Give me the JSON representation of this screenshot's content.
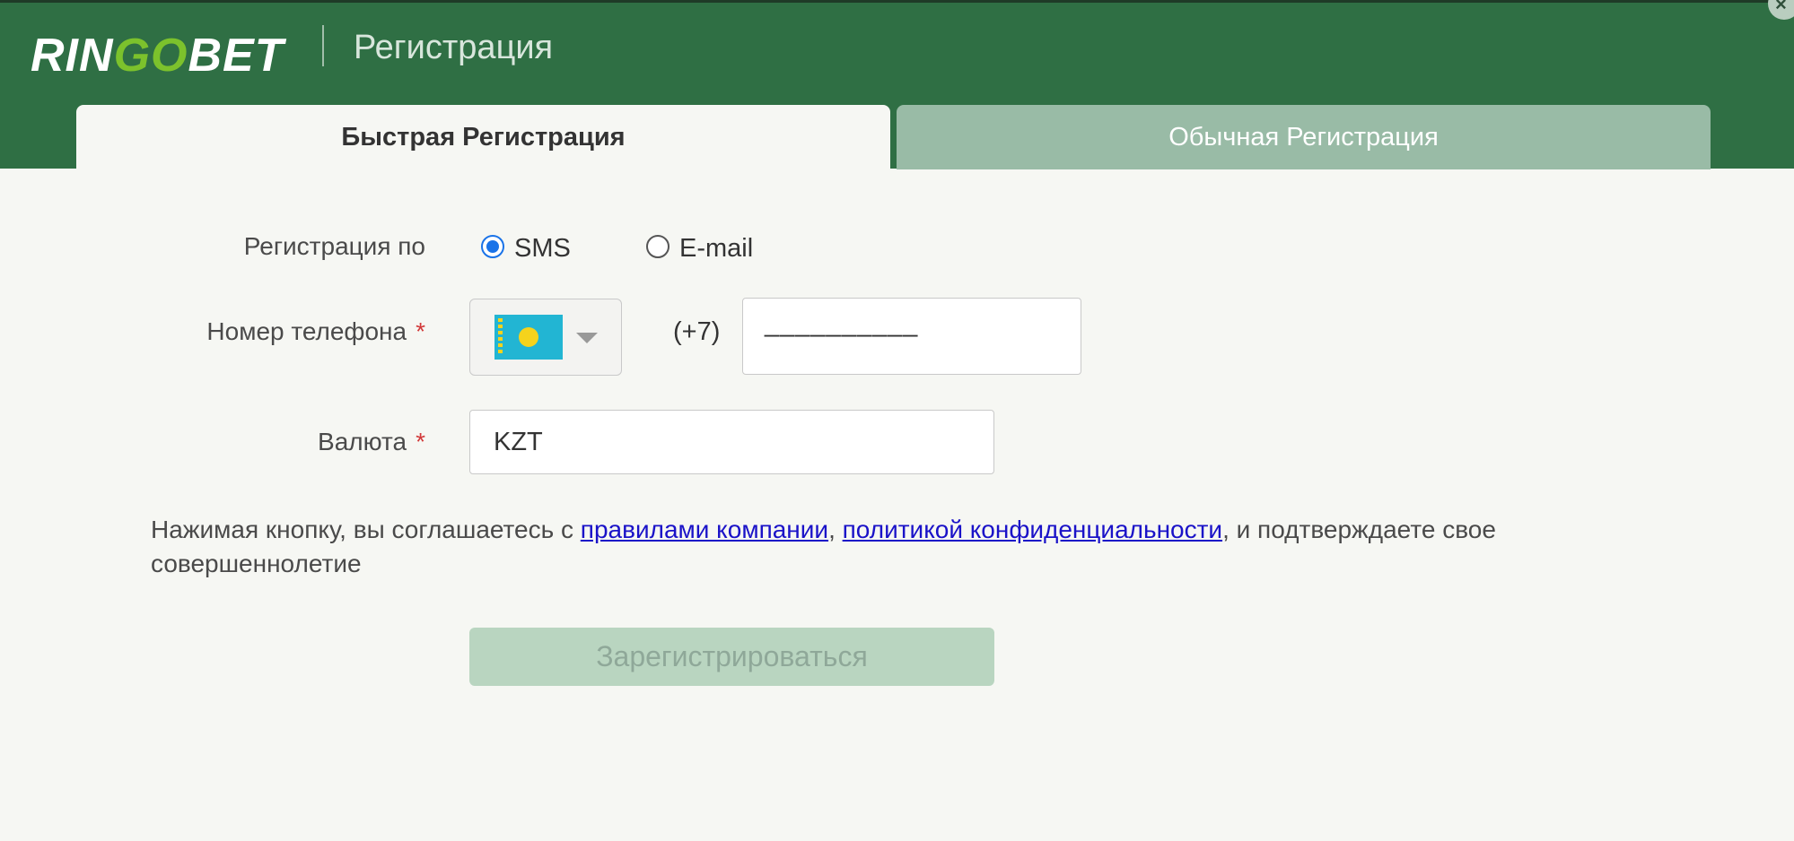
{
  "header": {
    "logo_ring": "RIN",
    "logo_go": "GO",
    "logo_bet": "BET",
    "title": "Регистрация",
    "close_label": "×"
  },
  "tabs": [
    {
      "label": "Быстрая Регистрация",
      "active": true
    },
    {
      "label": "Обычная Регистрация",
      "active": false
    }
  ],
  "form": {
    "registration_by_label": "Регистрация по",
    "options": [
      {
        "label": "SMS",
        "selected": true
      },
      {
        "label": "E-mail",
        "selected": false
      }
    ],
    "phone": {
      "label": "Номер телефона",
      "required_mark": "*",
      "country_flag": "kazakhstan-flag-icon",
      "prefix": "(+7)",
      "value": "__________"
    },
    "currency": {
      "label": "Валюта",
      "required_mark": "*",
      "value": "KZT"
    },
    "agreement": {
      "text_before": "Нажимая кнопку, вы соглашаетесь с ",
      "link_rules": "правилами компании",
      "separator": ", ",
      "link_privacy": "политикой конфиденциальности",
      "text_after": ", и подтверждаете свое совершеннолетие"
    },
    "submit_label": "Зарегистрироваться"
  },
  "colors": {
    "header_bg": "#2f6f44",
    "logo_accent": "#7cc22c",
    "inactive_tab": "#99bba6",
    "submit_disabled": "#b9d5c0",
    "radio_accent": "#1a73e8",
    "link": "#1a12c8",
    "required": "#d23a3a"
  }
}
